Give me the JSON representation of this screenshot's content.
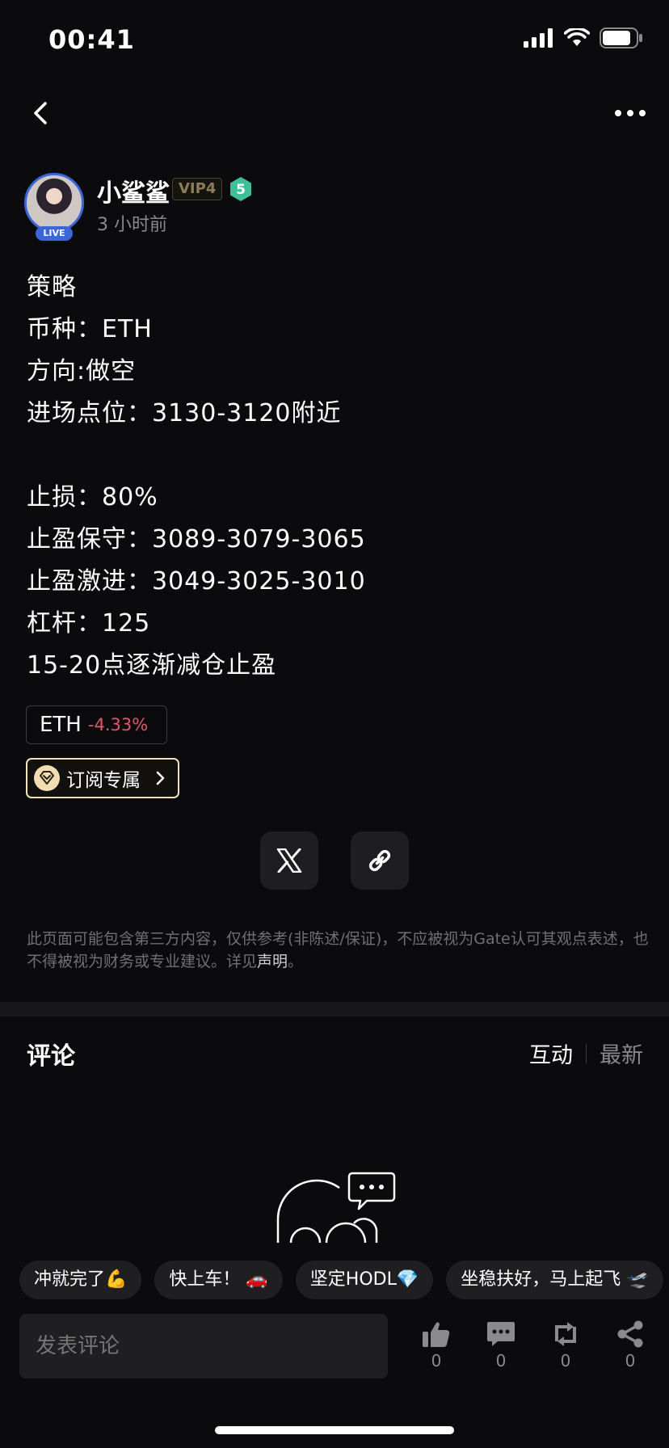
{
  "status_bar": {
    "time": "00:41"
  },
  "author": {
    "name": "小鲨鲨",
    "vip": "VIP4",
    "level": "5",
    "live": "LIVE",
    "posted": "3 小时前"
  },
  "post": {
    "lines": [
      "策略",
      "币种：ETH",
      "方向:做空",
      "进场点位：3130-3120附近",
      "",
      "止损：80%",
      "止盈保守：3089-3079-3065",
      "止盈激进：3049-3025-3010",
      "杠杆：125",
      "15-20点逐渐减仓止盈"
    ]
  },
  "coin_tag": {
    "symbol": "ETH",
    "change": "-4.33%"
  },
  "subscribe": {
    "label": "订阅专属"
  },
  "disclaimer": {
    "text": "此页面可能包含第三方内容，仅供参考(非陈述/保证)，不应被视为Gate认可其观点表述，也不得被视为财务或专业建议。详见",
    "link": "声明",
    "suffix": "。"
  },
  "comments": {
    "title": "评论",
    "tab_hot": "互动",
    "tab_new": "最新"
  },
  "quick_replies": [
    "冲就完了💪",
    "快上车！ 🚗",
    "坚定HODL💎",
    "坐稳扶好，马上起飞 🛫"
  ],
  "composer": {
    "placeholder": "发表评论"
  },
  "actions": {
    "like": "0",
    "comment": "0",
    "repost": "0",
    "share": "0"
  },
  "colors": {
    "background": "#0b0b0d",
    "negative": "#e0566c",
    "accent_gold": "#f3e2b8",
    "live_blue": "#3a66d8"
  },
  "icons": [
    "back-icon",
    "more-icon",
    "x-logo-icon",
    "link-icon",
    "thumbs-up-icon",
    "comment-icon",
    "repost-icon",
    "share-icon"
  ]
}
